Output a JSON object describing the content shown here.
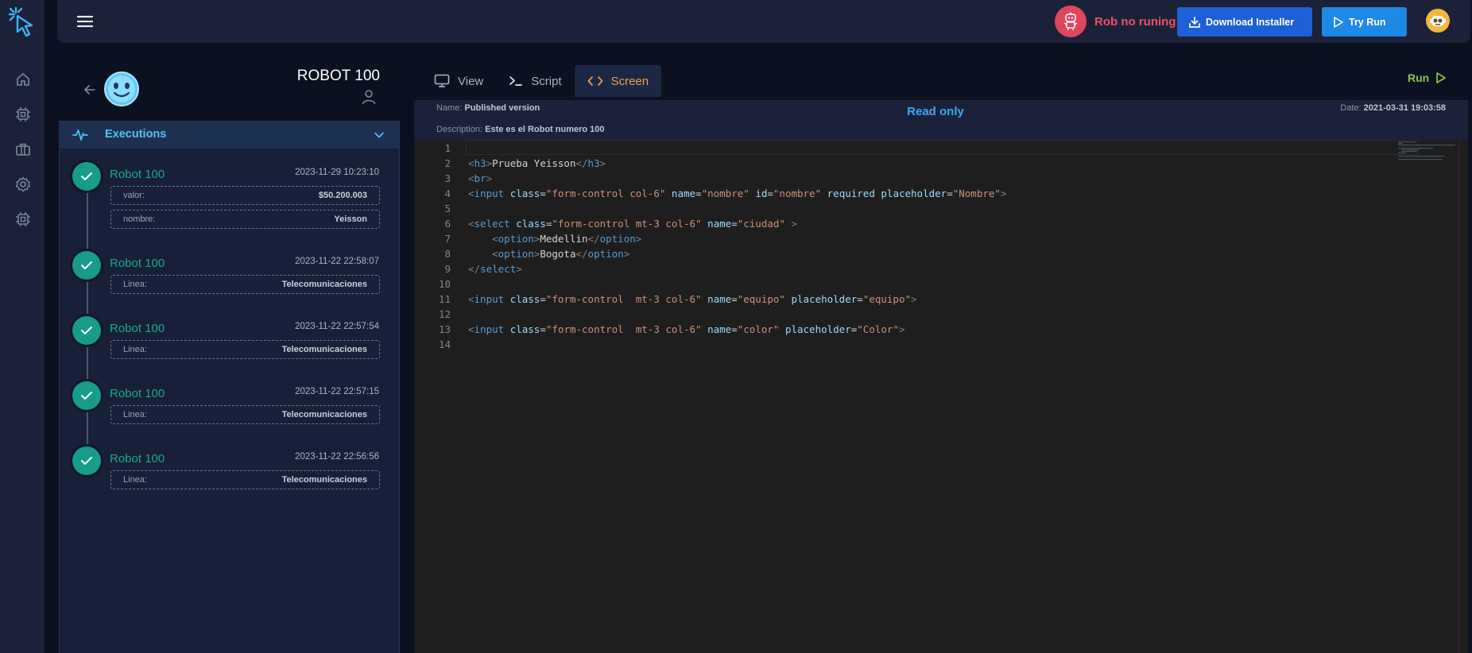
{
  "topbar": {
    "status_text": "Rob no runing",
    "download_label": "Download Installer",
    "try_run_label": "Try Run"
  },
  "robot": {
    "title": "ROBOT 100"
  },
  "executions": {
    "title": "Executions",
    "items": [
      {
        "name": "Robot 100",
        "date": "2023-11-29 10:23:10",
        "fields": [
          {
            "k": "valor:",
            "v": "$50.200.003"
          },
          {
            "k": "nombre:",
            "v": "Yeisson"
          }
        ]
      },
      {
        "name": "Robot 100",
        "date": "2023-11-22 22:58:07",
        "fields": [
          {
            "k": "Linea:",
            "v": "Telecomunicaciones"
          }
        ]
      },
      {
        "name": "Robot 100",
        "date": "2023-11-22 22:57:54",
        "fields": [
          {
            "k": "Linea:",
            "v": "Telecomunicaciones"
          }
        ]
      },
      {
        "name": "Robot 100",
        "date": "2023-11-22 22:57:15",
        "fields": [
          {
            "k": "Linea:",
            "v": "Telecomunicaciones"
          }
        ]
      },
      {
        "name": "Robot 100",
        "date": "2023-11-22 22:56:56",
        "fields": [
          {
            "k": "Linea:",
            "v": "Telecomunicaciones"
          }
        ]
      }
    ]
  },
  "tabs": [
    {
      "label": "View",
      "icon": "monitor-icon"
    },
    {
      "label": "Script",
      "icon": "terminal-icon"
    },
    {
      "label": "Screen",
      "icon": "code-icon",
      "active": true
    }
  ],
  "run_label": "Run",
  "meta": {
    "name_label": "Name:",
    "name_value": "Published version",
    "desc_label": "Description:",
    "desc_value": "Este es el Robot numero 100",
    "read_only": "Read only",
    "date_label": "Date:",
    "date_value": "2021-03-31 19:03:58"
  },
  "code_lines": [
    "",
    "<h3>Prueba Yeisson</h3>",
    "<br>",
    "<input class=\"form-control col-6\" name=\"nombre\" id=\"nombre\" required placeholder=\"Nombre\">",
    "",
    "<select class=\"form-control mt-3 col-6\" name=\"ciudad\" >",
    "    <option>Medellin</option>",
    "    <option>Bogota</option>",
    "</select>",
    "",
    "<input class=\"form-control  mt-3 col-6\" name=\"equipo\" placeholder=\"equipo\">",
    "",
    "<input class=\"form-control  mt-3 col-6\" name=\"color\" placeholder=\"Color\">",
    ""
  ],
  "colors": {
    "accent_blue": "#1d5fd6",
    "try_blue": "#1e88e5",
    "teal": "#169c88",
    "danger": "#ef4f6a",
    "orange_active": "#f0a04b",
    "run_green": "#8bc34a"
  }
}
